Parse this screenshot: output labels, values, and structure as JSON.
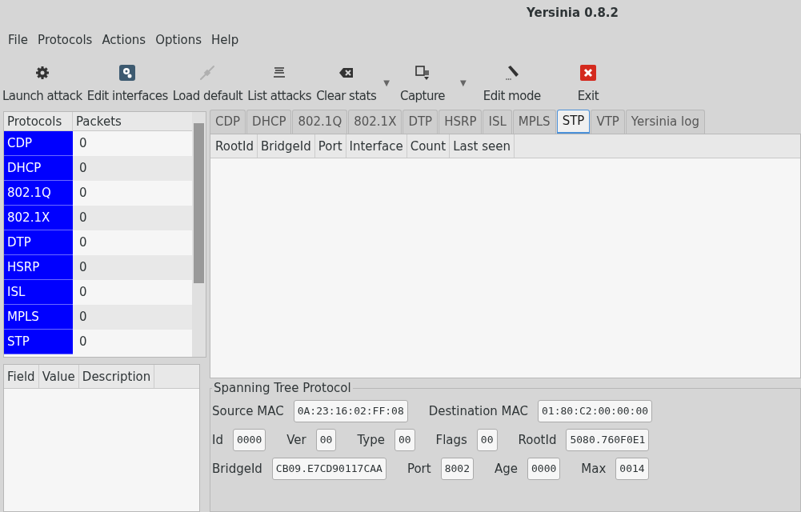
{
  "window": {
    "title": "Yersinia 0.8.2"
  },
  "menu": [
    "File",
    "Protocols",
    "Actions",
    "Options",
    "Help"
  ],
  "toolbar": [
    {
      "label": "Launch attack",
      "disabled": false,
      "dropdown": false
    },
    {
      "label": "Edit interfaces",
      "disabled": false,
      "dropdown": false
    },
    {
      "label": "Load default",
      "disabled": true,
      "dropdown": false
    },
    {
      "label": "List attacks",
      "disabled": false,
      "dropdown": false
    },
    {
      "label": "Clear stats",
      "disabled": false,
      "dropdown": true
    },
    {
      "label": "Capture",
      "disabled": false,
      "dropdown": true
    },
    {
      "label": "Edit mode",
      "disabled": false,
      "dropdown": false
    },
    {
      "label": "Exit",
      "disabled": false,
      "dropdown": false
    }
  ],
  "dropdown_glyph": "▼",
  "protocols_table": {
    "columns": [
      "Protocols",
      "Packets"
    ],
    "rows": [
      {
        "name": "CDP",
        "packets": "0"
      },
      {
        "name": "DHCP",
        "packets": "0"
      },
      {
        "name": "802.1Q",
        "packets": "0"
      },
      {
        "name": "802.1X",
        "packets": "0"
      },
      {
        "name": "DTP",
        "packets": "0"
      },
      {
        "name": "HSRP",
        "packets": "0"
      },
      {
        "name": "ISL",
        "packets": "0"
      },
      {
        "name": "MPLS",
        "packets": "0"
      },
      {
        "name": "STP",
        "packets": "0"
      }
    ]
  },
  "fields_table": {
    "columns": [
      "Field",
      "Value",
      "Description"
    ]
  },
  "tabs": [
    {
      "label": "CDP",
      "selected": false
    },
    {
      "label": "DHCP",
      "selected": false
    },
    {
      "label": "802.1Q",
      "selected": false
    },
    {
      "label": "802.1X",
      "selected": false
    },
    {
      "label": "DTP",
      "selected": false
    },
    {
      "label": "HSRP",
      "selected": false
    },
    {
      "label": "ISL",
      "selected": false
    },
    {
      "label": "MPLS",
      "selected": false
    },
    {
      "label": "STP",
      "selected": true
    },
    {
      "label": "VTP",
      "selected": false
    },
    {
      "label": "Yersinia log",
      "selected": false
    }
  ],
  "packets_table": {
    "columns": [
      "RootId",
      "BridgeId",
      "Port",
      "Interface",
      "Count",
      "Last seen"
    ]
  },
  "form": {
    "legend": "Spanning Tree Protocol",
    "lines": [
      {
        "fields": [
          {
            "label": "Source MAC",
            "value": "0A:23:16:02:FF:08"
          },
          {
            "label": "Destination MAC",
            "value": "01:80:C2:00:00:00"
          }
        ]
      },
      {
        "fields": [
          {
            "label": "Id",
            "value": "0000"
          },
          {
            "label": "Ver",
            "value": "00"
          },
          {
            "label": "Type",
            "value": "00"
          },
          {
            "label": "Flags",
            "value": "00"
          },
          {
            "label": "RootId",
            "value": "5080.760F0E1"
          }
        ]
      },
      {
        "fields": [
          {
            "label": "BridgeId",
            "value": "CB09.E7CD90117CAA"
          },
          {
            "label": "Port",
            "value": "8002"
          },
          {
            "label": "Age",
            "value": "0000"
          },
          {
            "label": "Max",
            "value": "0014"
          }
        ]
      }
    ]
  }
}
